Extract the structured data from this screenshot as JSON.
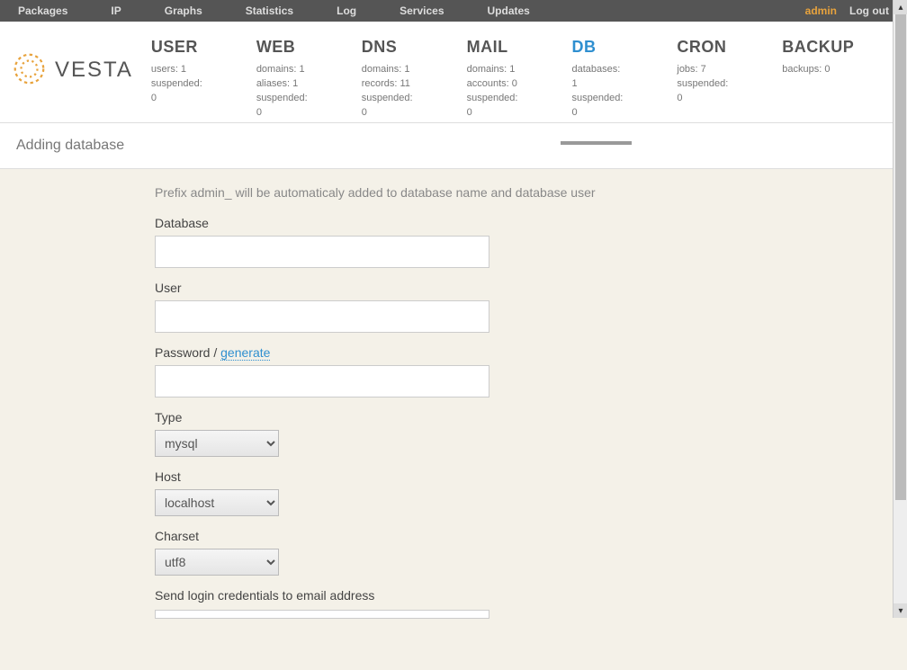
{
  "topbar": {
    "items": [
      "Packages",
      "IP",
      "Graphs",
      "Statistics",
      "Log",
      "Services",
      "Updates"
    ],
    "admin": "admin",
    "logout": "Log out"
  },
  "logo_text": "VESTA",
  "nav": {
    "user": {
      "title": "USER",
      "l1": "users: 1",
      "l2": "suspended: 0",
      "l3": ""
    },
    "web": {
      "title": "WEB",
      "l1": "domains: 1",
      "l2": "aliases: 1",
      "l3": "suspended: 0"
    },
    "dns": {
      "title": "DNS",
      "l1": "domains: 1",
      "l2": "records: 11",
      "l3": "suspended: 0"
    },
    "mail": {
      "title": "MAIL",
      "l1": "domains: 1",
      "l2": "accounts: 0",
      "l3": "suspended: 0"
    },
    "db": {
      "title": "DB",
      "l1": "databases: 1",
      "l2": "suspended: 0",
      "l3": ""
    },
    "cron": {
      "title": "CRON",
      "l1": "jobs: 7",
      "l2": "suspended: 0",
      "l3": ""
    },
    "backup": {
      "title": "BACKUP",
      "l1": "backups: 0",
      "l2": "",
      "l3": ""
    }
  },
  "page_title": "Adding database",
  "form": {
    "hint": "Prefix admin_ will be automaticaly added to database name and database user",
    "database_label": "Database",
    "database_value": "",
    "user_label": "User",
    "user_value": "",
    "password_label_prefix": "Password / ",
    "password_generate": "generate",
    "password_value": "",
    "type_label": "Type",
    "type_value": "mysql",
    "host_label": "Host",
    "host_value": "localhost",
    "charset_label": "Charset",
    "charset_value": "utf8",
    "email_label": "Send login credentials to email address"
  }
}
